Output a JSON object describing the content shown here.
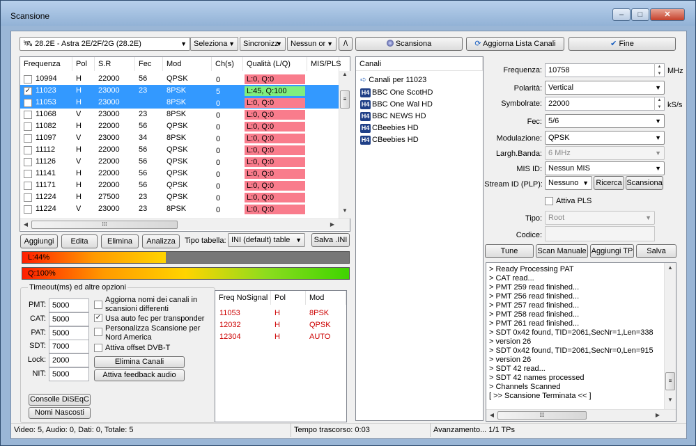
{
  "window": {
    "title": "Scansione",
    "minimize": "‒",
    "maximize": "□",
    "close": "✕"
  },
  "toolbar": {
    "satellite": "28.2E - Astra 2E/2F/2G (28.2E)",
    "select_combo": "Seleziona",
    "sync_combo": "Sincronizz",
    "none_combo": "Nessun or",
    "slash_btn": "/\\",
    "scan_btn": "Scansiona",
    "update_btn": "Aggiorna Lista Canali",
    "end_btn": "Fine"
  },
  "transponders": {
    "columns": [
      "Frequenza",
      "Pol",
      "S.R",
      "Fec",
      "Mod",
      "Ch(s)",
      "Qualità (L/Q)",
      "MIS/PLS"
    ],
    "rows": [
      {
        "freq": "10994",
        "pol": "H",
        "sr": "22000",
        "fec": "56",
        "mod": "QPSK",
        "ch": "0",
        "q": "L:0, Q:0",
        "checked": false,
        "selected": false,
        "good": false
      },
      {
        "freq": "11023",
        "pol": "H",
        "sr": "23000",
        "fec": "23",
        "mod": "8PSK",
        "ch": "5",
        "q": "L:45, Q:100",
        "checked": true,
        "selected": true,
        "good": true
      },
      {
        "freq": "11053",
        "pol": "H",
        "sr": "23000",
        "fec": "",
        "mod": "8PSK",
        "ch": "0",
        "q": "L:0, Q:0",
        "checked": false,
        "selected": true,
        "good": false
      },
      {
        "freq": "11068",
        "pol": "V",
        "sr": "23000",
        "fec": "23",
        "mod": "8PSK",
        "ch": "0",
        "q": "L:0, Q:0",
        "checked": false,
        "selected": false,
        "good": false
      },
      {
        "freq": "11082",
        "pol": "H",
        "sr": "22000",
        "fec": "56",
        "mod": "QPSK",
        "ch": "0",
        "q": "L:0, Q:0",
        "checked": false,
        "selected": false,
        "good": false
      },
      {
        "freq": "11097",
        "pol": "V",
        "sr": "23000",
        "fec": "34",
        "mod": "8PSK",
        "ch": "0",
        "q": "L:0, Q:0",
        "checked": false,
        "selected": false,
        "good": false
      },
      {
        "freq": "11112",
        "pol": "H",
        "sr": "22000",
        "fec": "56",
        "mod": "QPSK",
        "ch": "0",
        "q": "L:0, Q:0",
        "checked": false,
        "selected": false,
        "good": false
      },
      {
        "freq": "11126",
        "pol": "V",
        "sr": "22000",
        "fec": "56",
        "mod": "QPSK",
        "ch": "0",
        "q": "L:0, Q:0",
        "checked": false,
        "selected": false,
        "good": false
      },
      {
        "freq": "11141",
        "pol": "H",
        "sr": "22000",
        "fec": "56",
        "mod": "QPSK",
        "ch": "0",
        "q": "L:0, Q:0",
        "checked": false,
        "selected": false,
        "good": false
      },
      {
        "freq": "11171",
        "pol": "H",
        "sr": "22000",
        "fec": "56",
        "mod": "QPSK",
        "ch": "0",
        "q": "L:0, Q:0",
        "checked": false,
        "selected": false,
        "good": false
      },
      {
        "freq": "11224",
        "pol": "H",
        "sr": "27500",
        "fec": "23",
        "mod": "QPSK",
        "ch": "0",
        "q": "L:0, Q:0",
        "checked": false,
        "selected": false,
        "good": false
      },
      {
        "freq": "11224",
        "pol": "V",
        "sr": "23000",
        "fec": "23",
        "mod": "8PSK",
        "ch": "0",
        "q": "L:0, Q:0",
        "checked": false,
        "selected": false,
        "good": false
      }
    ]
  },
  "table_actions": {
    "add": "Aggiungi",
    "edit": "Edita",
    "delete": "Elimina",
    "analyze": "Analizza",
    "type_label": "Tipo tabella:",
    "type_value": "INI (default) table",
    "save": "Salva .INI"
  },
  "levels": {
    "level_text": "L:44%",
    "level_value": 0.44,
    "quality_text": "Q:100%",
    "quality_value": 1.0
  },
  "timeouts": {
    "title": "Timeout(ms) ed altre opzioni",
    "pmt_label": "PMT:",
    "pmt": "5000",
    "cat_label": "CAT:",
    "cat": "5000",
    "pat_label": "PAT:",
    "pat": "5000",
    "sdt_label": "SDT:",
    "sdt": "7000",
    "lock_label": "Lock:",
    "lock": "2000",
    "nit_label": "NIT:",
    "nit": "5000"
  },
  "options": {
    "opt1": "Aggiorna nomi dei canali in",
    "opt1b": "scansioni differenti",
    "opt2": "Usa auto fec per transponder",
    "opt3": "Personalizza Scansione per",
    "opt3b": "Nord America",
    "opt4": "Attiva offset DVB-T",
    "delete_channels": "Elimina Canali",
    "audio_feedback": "Attiva feedback audio",
    "diseqc": "Consolle DiSEqC",
    "hidden_names": "Nomi Nascosti",
    "checked_mark": "✓"
  },
  "nosignal": {
    "columns": [
      "Freq NoSignal",
      "Pol",
      "Mod"
    ],
    "rows": [
      {
        "freq": "11053",
        "pol": "H",
        "mod": "8PSK"
      },
      {
        "freq": "12032",
        "pol": "H",
        "mod": "QPSK"
      },
      {
        "freq": "12304",
        "pol": "H",
        "mod": "AUTO"
      }
    ]
  },
  "channels": {
    "header": "Canali",
    "root": "Canali per 11023",
    "badge": "H4",
    "items": [
      "BBC One ScotHD",
      "BBC One Wal HD",
      "BBC NEWS HD",
      "CBeebies HD",
      "CBeebies HD"
    ]
  },
  "tuner": {
    "freq_label": "Frequenza:",
    "freq": "10758",
    "freq_unit": "MHz",
    "pol_label": "Polarità:",
    "pol": "Vertical",
    "sr_label": "Symbolrate:",
    "sr": "22000",
    "sr_unit": "kS/s",
    "fec_label": "Fec:",
    "fec": "5/6",
    "mod_label": "Modulazione:",
    "mod": "QPSK",
    "bw_label": "Largh.Banda:",
    "bw": "6 MHz",
    "mis_label": "MIS ID:",
    "mis": "Nessun MIS",
    "plp_label": "Stream ID (PLP):",
    "plp": "Nessuno",
    "search_btn": "Ricerca",
    "scan_btn": "Scansiona",
    "pls_label": "Attiva PLS",
    "type_label": "Tipo:",
    "type": "Root",
    "code_label": "Codice:",
    "code": "",
    "tune_btn": "Tune",
    "manual_btn": "Scan Manuale",
    "add_tp_btn": "Aggiungi TP",
    "save_btn": "Salva"
  },
  "log": [
    ">     Ready Processing PAT",
    ">     CAT read...",
    ">     PMT 259 read finished...",
    ">     PMT 256 read finished...",
    ">     PMT 257 read finished...",
    ">     PMT 258 read finished...",
    ">     PMT 261 read finished...",
    ">     SDT 0x42 found, TID=2061,SecNr=1,Len=338",
    ">     version 26",
    ">     SDT 0x42 found, TID=2061,SecNr=0,Len=915",
    ">     version 26",
    ">     SDT 42 read...",
    ">     SDT 42 names processed",
    ">     Channels Scanned",
    "[  >> Scansione Terminata << ]"
  ],
  "status": {
    "counts": "Video: 5, Audio: 0, Dati: 0, Totale: 5",
    "elapsed": "Tempo trascorso: 0:03",
    "progress": "Avanzamento... 1/1 TPs"
  },
  "colors": {
    "accent": "#3399ff",
    "bad_quality": "#f97c8c",
    "good_quality": "#7fee7f",
    "nosignal_text": "#cc0000"
  }
}
